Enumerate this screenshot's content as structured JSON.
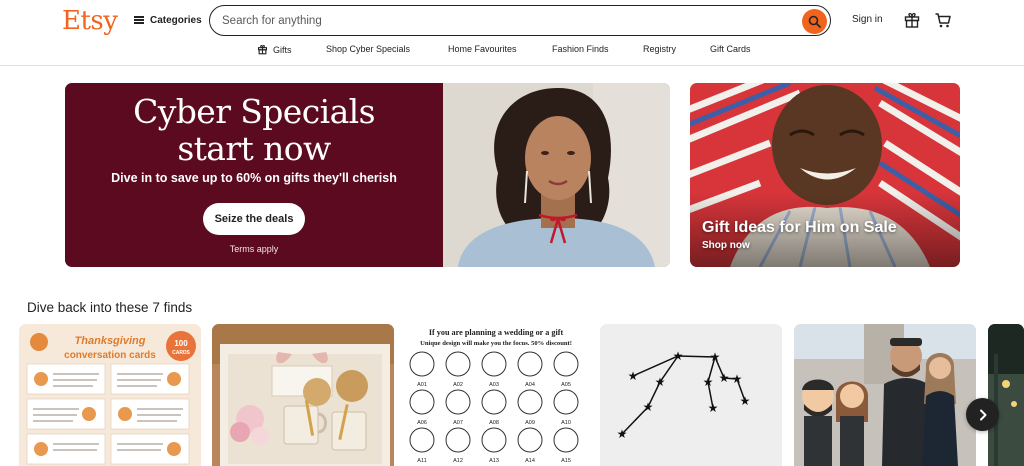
{
  "header": {
    "logo": "Etsy",
    "categories_label": "Categories",
    "search": {
      "placeholder": "Search for anything",
      "value": ""
    },
    "signin_label": "Sign in",
    "icons": {
      "search": "search-icon",
      "gift": "gift-icon",
      "cart": "cart-icon",
      "menu": "hamburger-icon"
    }
  },
  "subnav": {
    "items": [
      {
        "label": "Gifts",
        "icon": "gift-icon"
      },
      {
        "label": "Shop Cyber Specials"
      },
      {
        "label": "Home Favourites"
      },
      {
        "label": "Fashion Finds"
      },
      {
        "label": "Registry"
      },
      {
        "label": "Gift Cards"
      }
    ]
  },
  "hero": {
    "title_line1": "Cyber Specials",
    "title_line2": "start now",
    "subtitle": "Dive in to save up to 60% on gifts they'll cherish",
    "cta_label": "Seize the deals",
    "terms_label": "Terms apply"
  },
  "side_hero": {
    "title": "Gift Ideas for Him on Sale",
    "link_label": "Shop now"
  },
  "finds": {
    "title": "Dive back into these 7 finds",
    "card1": {
      "heading_line1": "Thanksgiving",
      "heading_line2": "conversation cards",
      "badge_num": "100",
      "badge_unit": "CARDS"
    },
    "card3": {
      "line1": "If you are planning a wedding or a gift",
      "line2": "Unique design will make you the focus. 50% discount!",
      "codes": [
        "A01",
        "A02",
        "A03",
        "A04",
        "A05",
        "A06",
        "A07",
        "A08",
        "A09",
        "A10",
        "A11",
        "A12",
        "A13",
        "A14",
        "A15"
      ]
    }
  },
  "colors": {
    "brand": "#f1641e",
    "hero_bg": "#5b0a1f",
    "text": "#222222"
  }
}
